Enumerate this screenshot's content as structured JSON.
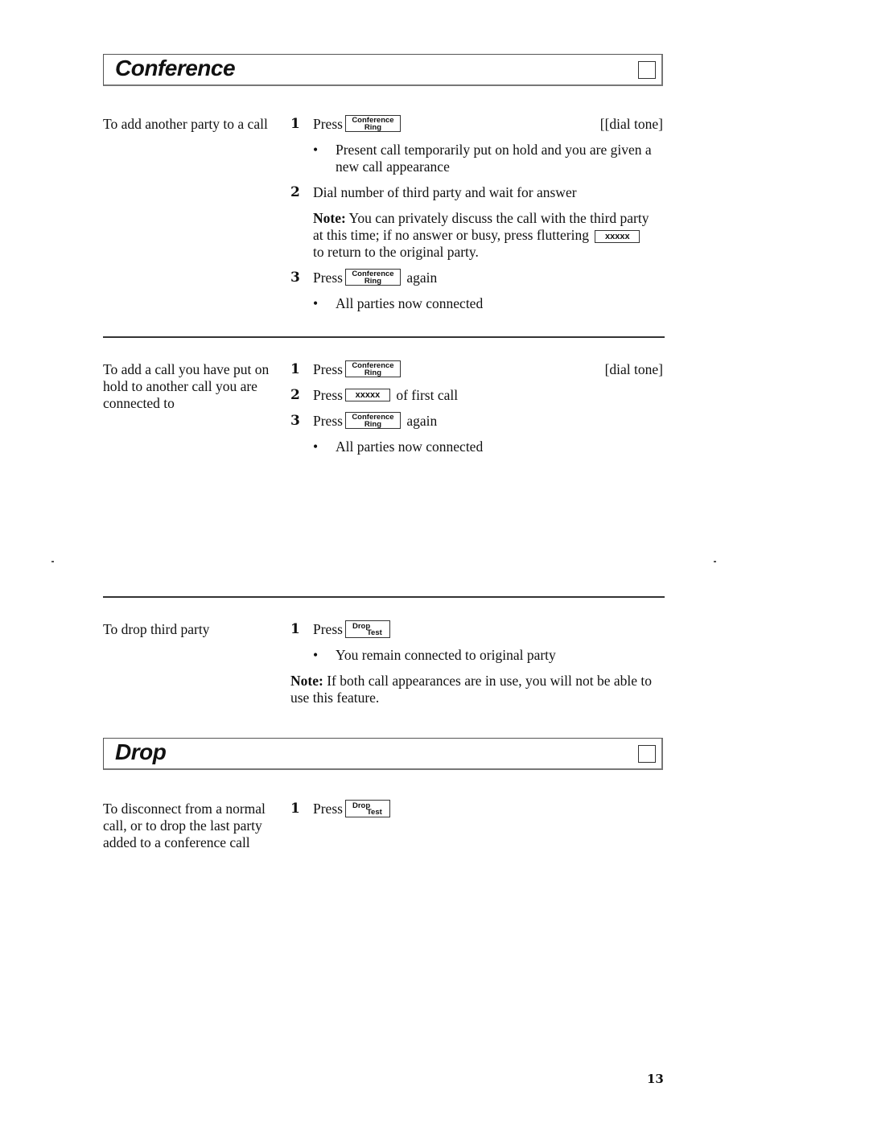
{
  "sections": {
    "conference": {
      "title": "Conference",
      "block1": {
        "description": "To add another party to a call",
        "step1": {
          "num": "1",
          "press": "Press",
          "key_top": "Conference",
          "key_bottom": "Ring",
          "right": "[[dial tone]"
        },
        "bullet1": "Present call temporarily put on hold and you are given a new call appearance",
        "step2": {
          "num": "2",
          "text": "Dial number of third party and wait for answer"
        },
        "note": {
          "label": "Note:",
          "text_before": "You can privately discuss the call with the third party at this time; if no answer or busy, press fluttering",
          "key": "xxxxx",
          "text_after": "to return to the original party."
        },
        "step3": {
          "num": "3",
          "press": "Press",
          "key_top": "Conference",
          "key_bottom": "Ring",
          "after": "again"
        },
        "bullet3": "All parties now connected"
      },
      "block2": {
        "description": "To add a call you have put on hold to another call you are connected to",
        "step1": {
          "num": "1",
          "press": "Press",
          "key_top": "Conference",
          "key_bottom": "Ring",
          "right": "[dial tone]"
        },
        "step2": {
          "num": "2",
          "press": "Press",
          "key": "xxxxx",
          "after": "of first call"
        },
        "step3": {
          "num": "3",
          "press": "Press",
          "key_top": "Conference",
          "key_bottom": "Ring",
          "after": "again"
        },
        "bullet3": "All parties now connected"
      },
      "block3": {
        "description": "To drop third party",
        "step1": {
          "num": "1",
          "press": "Press",
          "key_top": "Drop",
          "key_bottom": "Test"
        },
        "bullet1": "You remain connected to original party",
        "note": {
          "label": "Note:",
          "text": "If both call appearances are in use, you will not be able to use this feature."
        }
      }
    },
    "drop": {
      "title": "Drop",
      "block1": {
        "description": "To disconnect from a normal call, or to drop the last party added to a conference call",
        "step1": {
          "num": "1",
          "press": "Press",
          "key_top": "Drop",
          "key_bottom": "Test"
        }
      }
    }
  },
  "page_number": "13",
  "bullet_glyph": "•"
}
